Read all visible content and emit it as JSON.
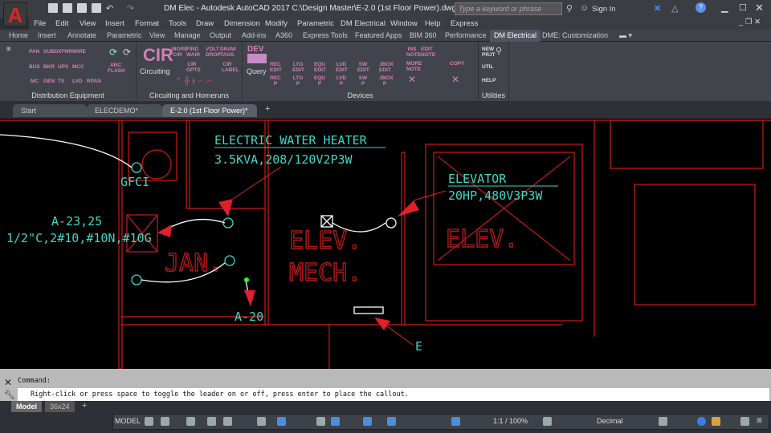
{
  "app": {
    "logo_letter": "A",
    "title": "DM Elec - Autodesk AutoCAD 2017   C:\\Design Master\\E-2.0 (1st Floor Power).dwg",
    "search_placeholder": "Type a keyword or phrase",
    "sign_in": "Sign In"
  },
  "menu": [
    "File",
    "Edit",
    "View",
    "Insert",
    "Format",
    "Tools",
    "Draw",
    "Dimension",
    "Modify",
    "Parametric",
    "DM Electrical",
    "Window",
    "Help",
    "Express"
  ],
  "ribbon_tabs": [
    "Home",
    "Insert",
    "Annotate",
    "Parametric",
    "View",
    "Manage",
    "Output",
    "Add-ins",
    "A360",
    "Express Tools",
    "Featured Apps",
    "BIM 360",
    "Performance",
    "DM Electrical",
    "DME: Customization"
  ],
  "active_ribbon_tab": "DM Electrical",
  "panels": {
    "distribution": {
      "label": "Distribution Equipment",
      "buttons": [
        "PAN",
        "SUBD",
        "XFMR",
        "WIRE",
        "BUS",
        "BKR",
        "UPS",
        "MCC",
        "MC",
        "GEN",
        "TS",
        "LVD",
        "RPAN",
        "ARC FLASH"
      ]
    },
    "circuiting": {
      "label": "Circuiting and Homeruns",
      "big": "CIR",
      "big_label": "Circuiting",
      "buttons": [
        "MORE CIR",
        "FIND WAIR",
        "VOLT DROP",
        "DRAW TAGS",
        "CIR OPTS",
        "CIR LABEL"
      ]
    },
    "devices": {
      "label": "Devices",
      "big": "DEV",
      "big_label": "Query",
      "buttons": [
        "REC EDIT",
        "LTG EDIT",
        "EQU EDIT",
        "LVD EDIT",
        "SW EDIT",
        "JBOX EDIT",
        "REC P",
        "LTG P",
        "EQU P",
        "LVD P",
        "SW P",
        "JBOX P",
        "INS NOTE",
        "EDIT NOTE",
        "MORE NOTE",
        "COPY"
      ]
    },
    "utilities": {
      "label": "Utilities",
      "buttons": [
        "NEW PRJT",
        "UTIL",
        "HELP"
      ]
    }
  },
  "doc_tabs": [
    {
      "label": "Start"
    },
    {
      "label": "ELECDEMO*"
    },
    {
      "label": "E-2.0 (1st Floor Power)*",
      "active": true
    }
  ],
  "drawing": {
    "labels": {
      "heater_title": "ELECTRIC WATER HEATER",
      "heater_spec": "3.5KVA,208/120V2P3W",
      "elevator_title": "ELEVATOR",
      "elevator_spec": "20HP,480V3P3W",
      "gfci": "GFCI",
      "circuit": "A-23,25",
      "conduit": "1/2\"C,2#10,#10N,#10G",
      "a20": "A-20",
      "e": "E",
      "room_jan": "JAN.",
      "room_elev_mech": "ELEV.",
      "room_mech": "MECH.",
      "room_elev": "ELEV."
    },
    "colors": {
      "plan": "#b01818",
      "text": "#3fd6c6",
      "leader": "#ffffff",
      "arrow": "#e0202a"
    }
  },
  "command": {
    "label": "Command:",
    "prompt": "Right-click or press space to toggle the leader on or off, press enter to place the callout."
  },
  "layout_tabs": [
    "Model",
    "36x24"
  ],
  "status": {
    "model": "MODEL",
    "scale": "1:1 / 100%",
    "units": "Decimal"
  }
}
